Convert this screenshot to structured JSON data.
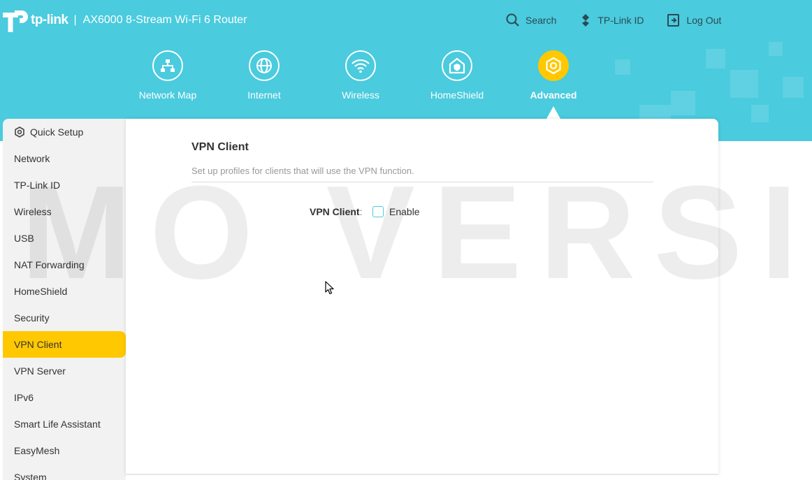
{
  "header": {
    "brand": "tp-link",
    "separator": "|",
    "model": "AX6000 8-Stream Wi-Fi 6 Router",
    "links": [
      {
        "label": "Search",
        "icon": "search-icon"
      },
      {
        "label": "TP-Link ID",
        "icon": "tplink-id-icon"
      },
      {
        "label": "Log Out",
        "icon": "logout-icon"
      }
    ]
  },
  "nav": {
    "items": [
      {
        "label": "Network Map",
        "icon": "network-map-icon"
      },
      {
        "label": "Internet",
        "icon": "globe-icon"
      },
      {
        "label": "Wireless",
        "icon": "wifi-icon"
      },
      {
        "label": "HomeShield",
        "icon": "homeshield-icon"
      },
      {
        "label": "Advanced",
        "icon": "gear-icon",
        "active": true
      }
    ]
  },
  "sidebar": {
    "items": [
      {
        "label": "Quick Setup",
        "icon": "gear-icon"
      },
      {
        "label": "Network"
      },
      {
        "label": "TP-Link ID"
      },
      {
        "label": "Wireless"
      },
      {
        "label": "USB"
      },
      {
        "label": "NAT Forwarding"
      },
      {
        "label": "HomeShield"
      },
      {
        "label": "Security"
      },
      {
        "label": "VPN Client",
        "active": true
      },
      {
        "label": "VPN Server"
      },
      {
        "label": "IPv6"
      },
      {
        "label": "Smart Life Assistant"
      },
      {
        "label": "EasyMesh"
      },
      {
        "label": "System"
      }
    ]
  },
  "main": {
    "title": "VPN Client",
    "description": "Set up profiles for clients that will use the VPN function.",
    "field_label": "VPN Client",
    "field_colon": ":",
    "checkbox_label": "Enable",
    "checkbox_checked": false
  },
  "watermark": "MO VERSIO",
  "colors": {
    "header": "#4acbde",
    "accent": "#ffc800",
    "sidebar": "#f2f2f2"
  }
}
